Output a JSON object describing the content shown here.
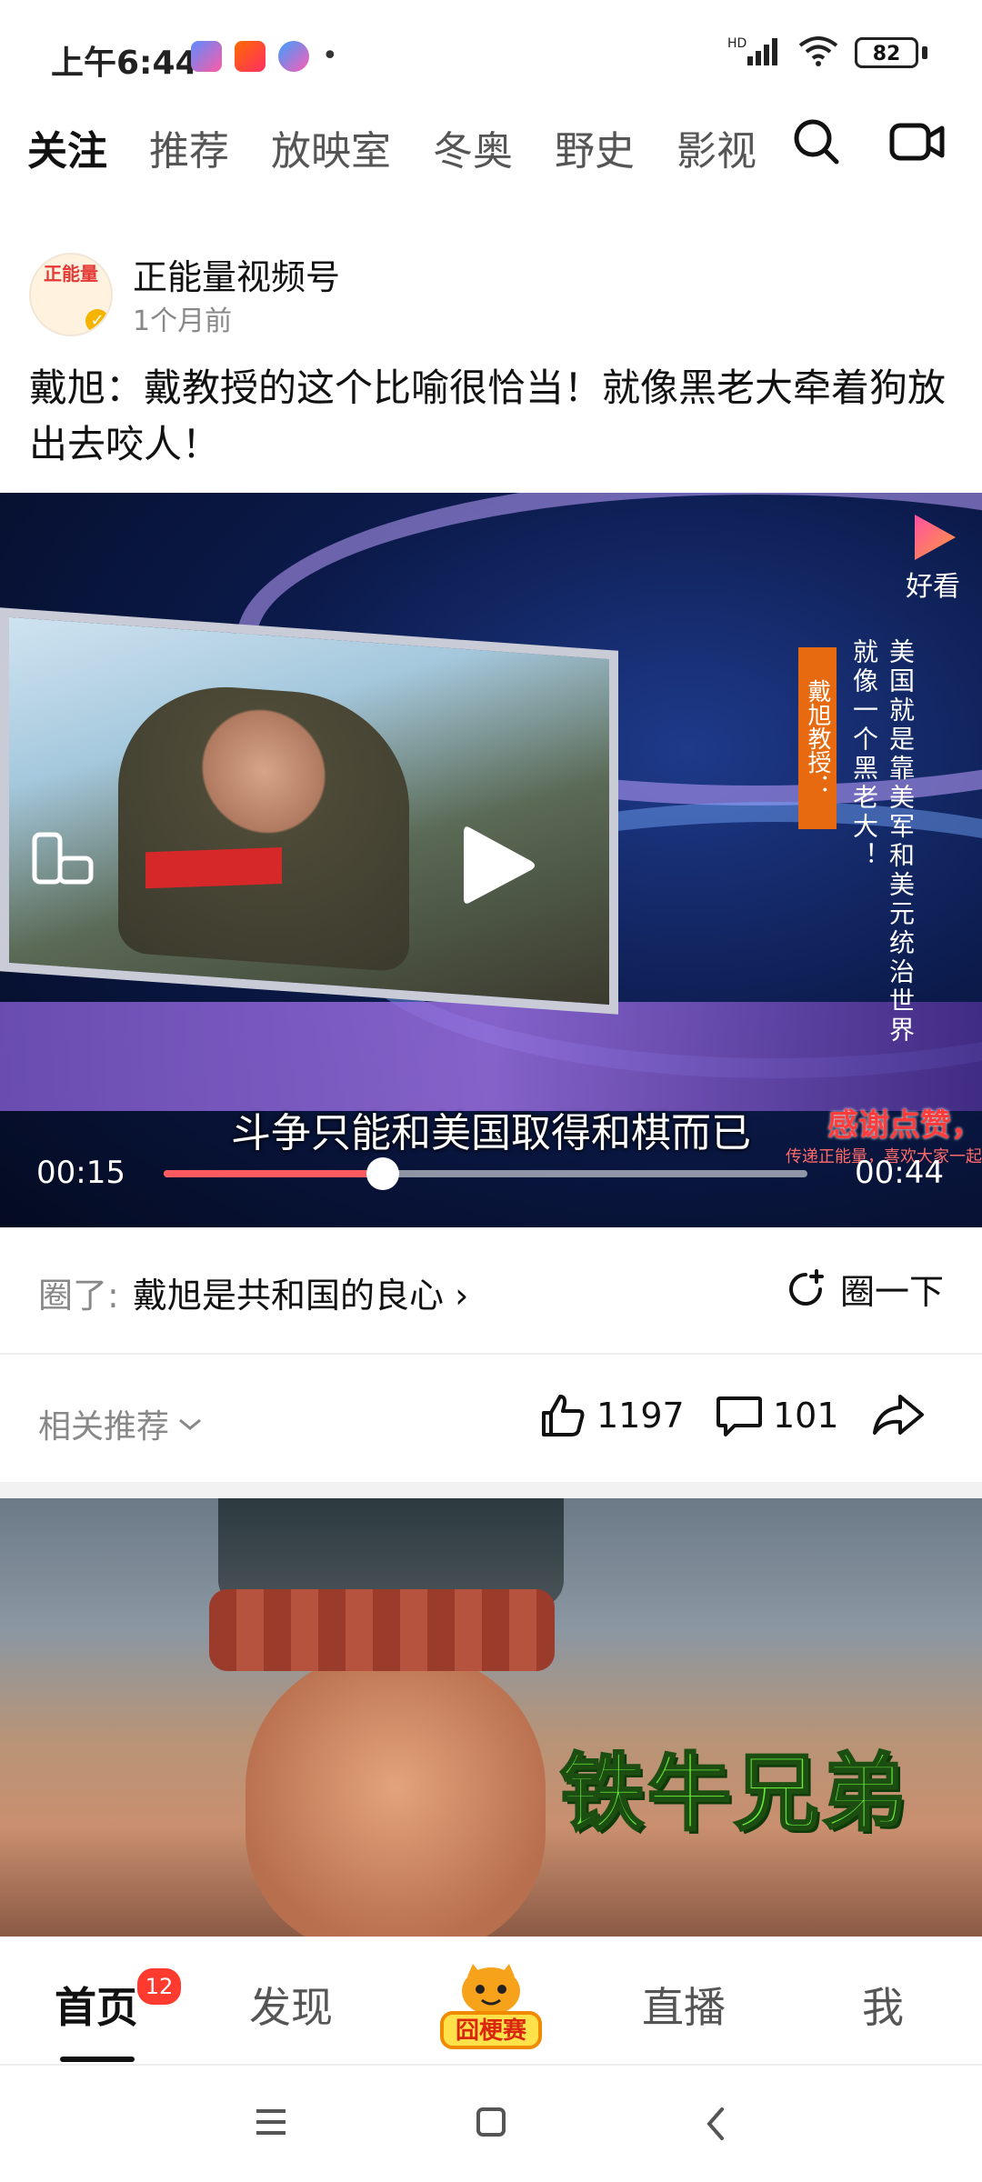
{
  "status_bar": {
    "time": "上午6:44",
    "network": "HD",
    "battery": "82"
  },
  "top_nav": {
    "tabs": [
      "关注",
      "推荐",
      "放映室",
      "冬奥",
      "野史",
      "影视"
    ],
    "active_tab": "关注"
  },
  "post": {
    "author_name": "正能量视频号",
    "avatar_text": "正能量",
    "time_ago": "1个月前",
    "title": "戴旭：戴教授的这个比喻很恰当！就像黑老大牵着狗放出去咬人！"
  },
  "video": {
    "watermark": "好看",
    "vertical_text_right": "美国就是靠美军和美元统治世界",
    "vertical_text_mid": "就像一个黑老大！",
    "vertical_text_orange": "戴旭教授：",
    "subtitle": "斗争只能和美国取得和棋而已",
    "thanks_text": "感谢点赞，",
    "thanks_sub": "传递正能量，喜欢大家一起",
    "current_time": "00:15",
    "duration": "00:44",
    "progress": 0.34
  },
  "circle": {
    "label": "圈了:",
    "name": "戴旭是共和国的良心",
    "join_label": "圈一下"
  },
  "actions": {
    "related_label": "相关推荐",
    "likes": "1197",
    "comments": "101"
  },
  "next_video": {
    "overlay_text": "铁牛兄弟"
  },
  "bottom_nav": {
    "items": [
      "首页",
      "发现",
      "直播",
      "我"
    ],
    "badge": "12",
    "center_logo_text": "囧梗赛"
  },
  "colors": {
    "accent": "#ff5a5f",
    "badge": "#ff3b30",
    "text_primary": "#111111",
    "text_secondary": "#888888"
  }
}
